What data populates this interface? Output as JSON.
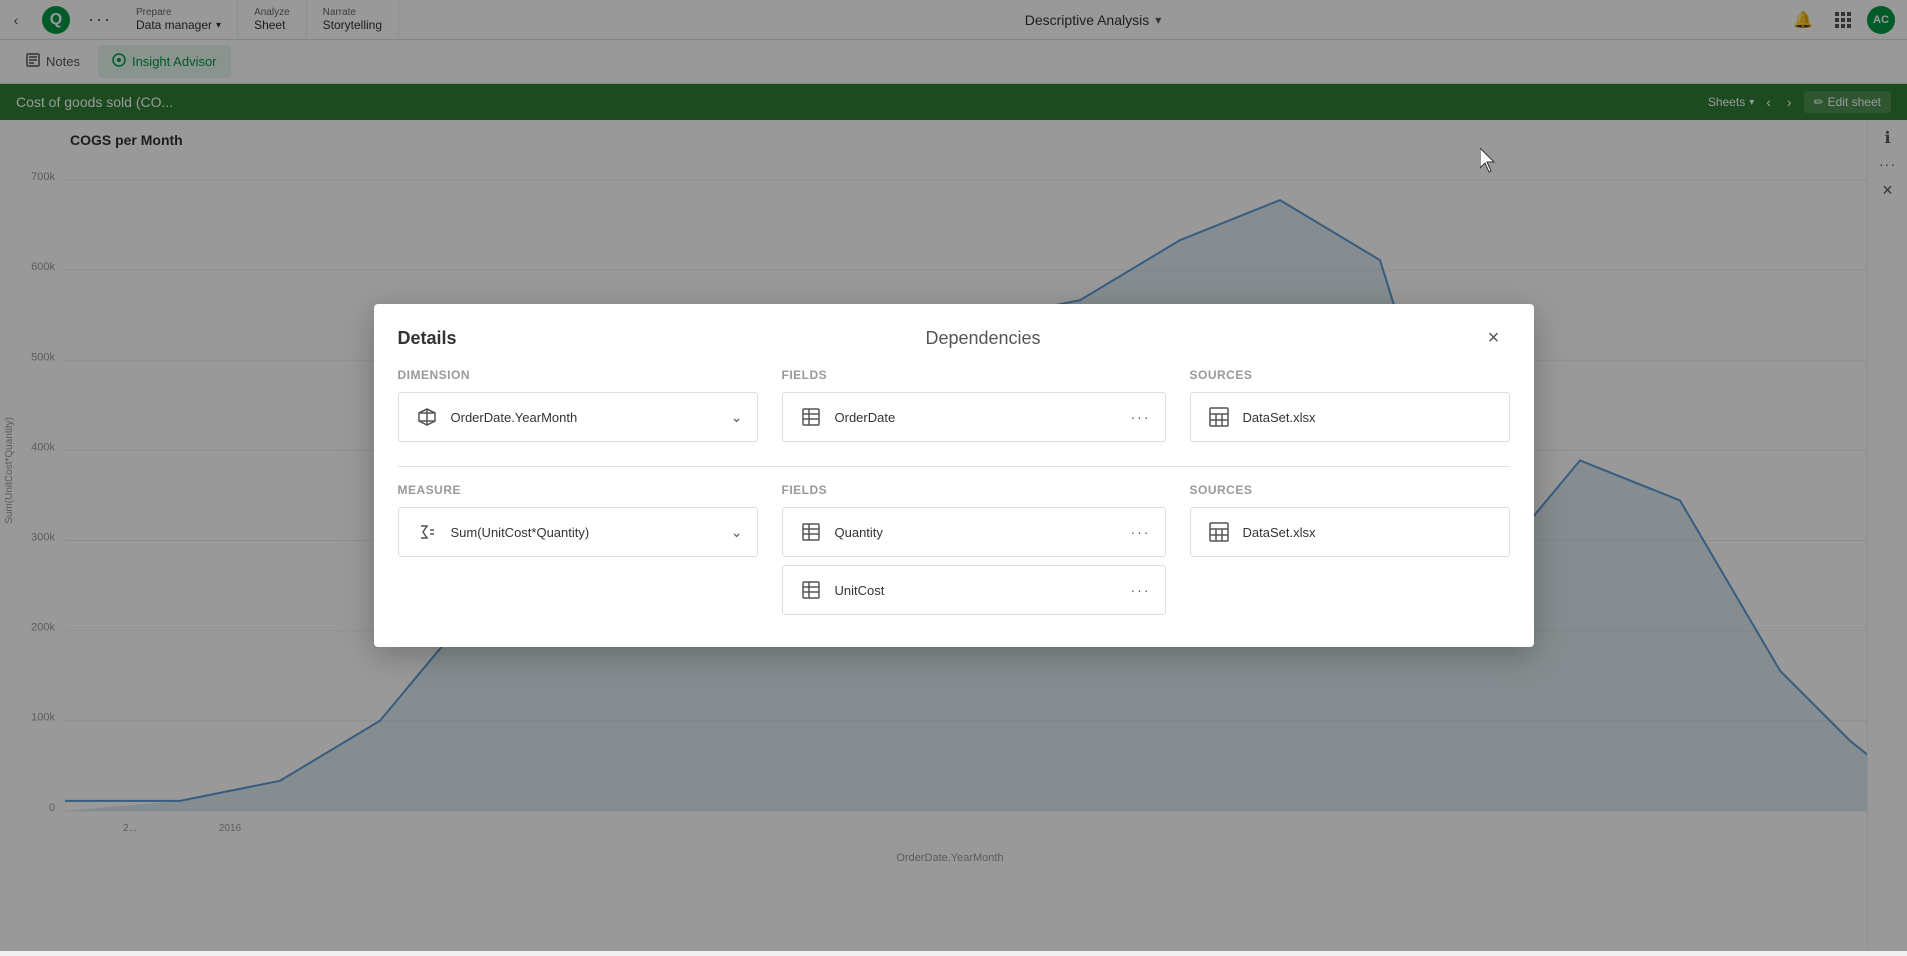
{
  "app": {
    "title": "Descriptive Analysis"
  },
  "topnav": {
    "back_icon": "‹",
    "logo_text": "Q",
    "more_icon": "···",
    "sections": [
      {
        "top": "Prepare",
        "bottom": "Data manager",
        "has_arrow": true
      },
      {
        "top": "Analyze",
        "bottom": "Sheet",
        "has_arrow": false
      },
      {
        "top": "Narrate",
        "bottom": "Storytelling",
        "has_arrow": false
      }
    ],
    "title": "Descriptive Analysis",
    "dropdown_icon": "▾",
    "bell_icon": "🔔",
    "grid_icon": "⊞",
    "avatar": "AC"
  },
  "secondarynav": {
    "tabs": [
      {
        "label": "Notes",
        "icon": "📝",
        "active": false
      },
      {
        "label": "Insight Advisor",
        "icon": "💡",
        "active": true
      }
    ]
  },
  "page_title": "Cost of goods sold (CO...",
  "page_title_right": {
    "sheets_label": "Sheets",
    "edit_sheet_label": "Edit sheet",
    "pencil_icon": "✏"
  },
  "chart": {
    "title": "COGS per Month",
    "y_axis": [
      "700k",
      "600k",
      "500k",
      "400k",
      "300k",
      "200k",
      "100k",
      "0"
    ],
    "x_label": "OrderDate.YearMonth",
    "x_ticks": [
      "2...",
      "2016"
    ]
  },
  "modal": {
    "title_details": "Details",
    "title_dependencies": "Dependencies",
    "close_icon": "×",
    "dimension_section": {
      "label": "Dimension",
      "item": {
        "text": "OrderDate.YearMonth",
        "icon_type": "cube"
      }
    },
    "dimension_fields": {
      "label": "Fields",
      "item": {
        "text": "OrderDate",
        "icon_type": "table"
      }
    },
    "dimension_sources": {
      "label": "Sources",
      "item": {
        "text": "DataSet.xlsx",
        "icon_type": "grid"
      }
    },
    "measure_section": {
      "label": "Measure",
      "item": {
        "text": "Sum(UnitCost*Quantity)",
        "icon_type": "formula"
      }
    },
    "measure_fields": {
      "label": "Fields",
      "items": [
        {
          "text": "Quantity",
          "icon_type": "table"
        },
        {
          "text": "UnitCost",
          "icon_type": "table"
        }
      ]
    },
    "measure_sources": {
      "label": "Sources",
      "item": {
        "text": "DataSet.xlsx",
        "icon_type": "grid"
      }
    }
  },
  "info_panel": {
    "info_icon": "ℹ",
    "more_icon": "···",
    "close_icon": "×"
  }
}
